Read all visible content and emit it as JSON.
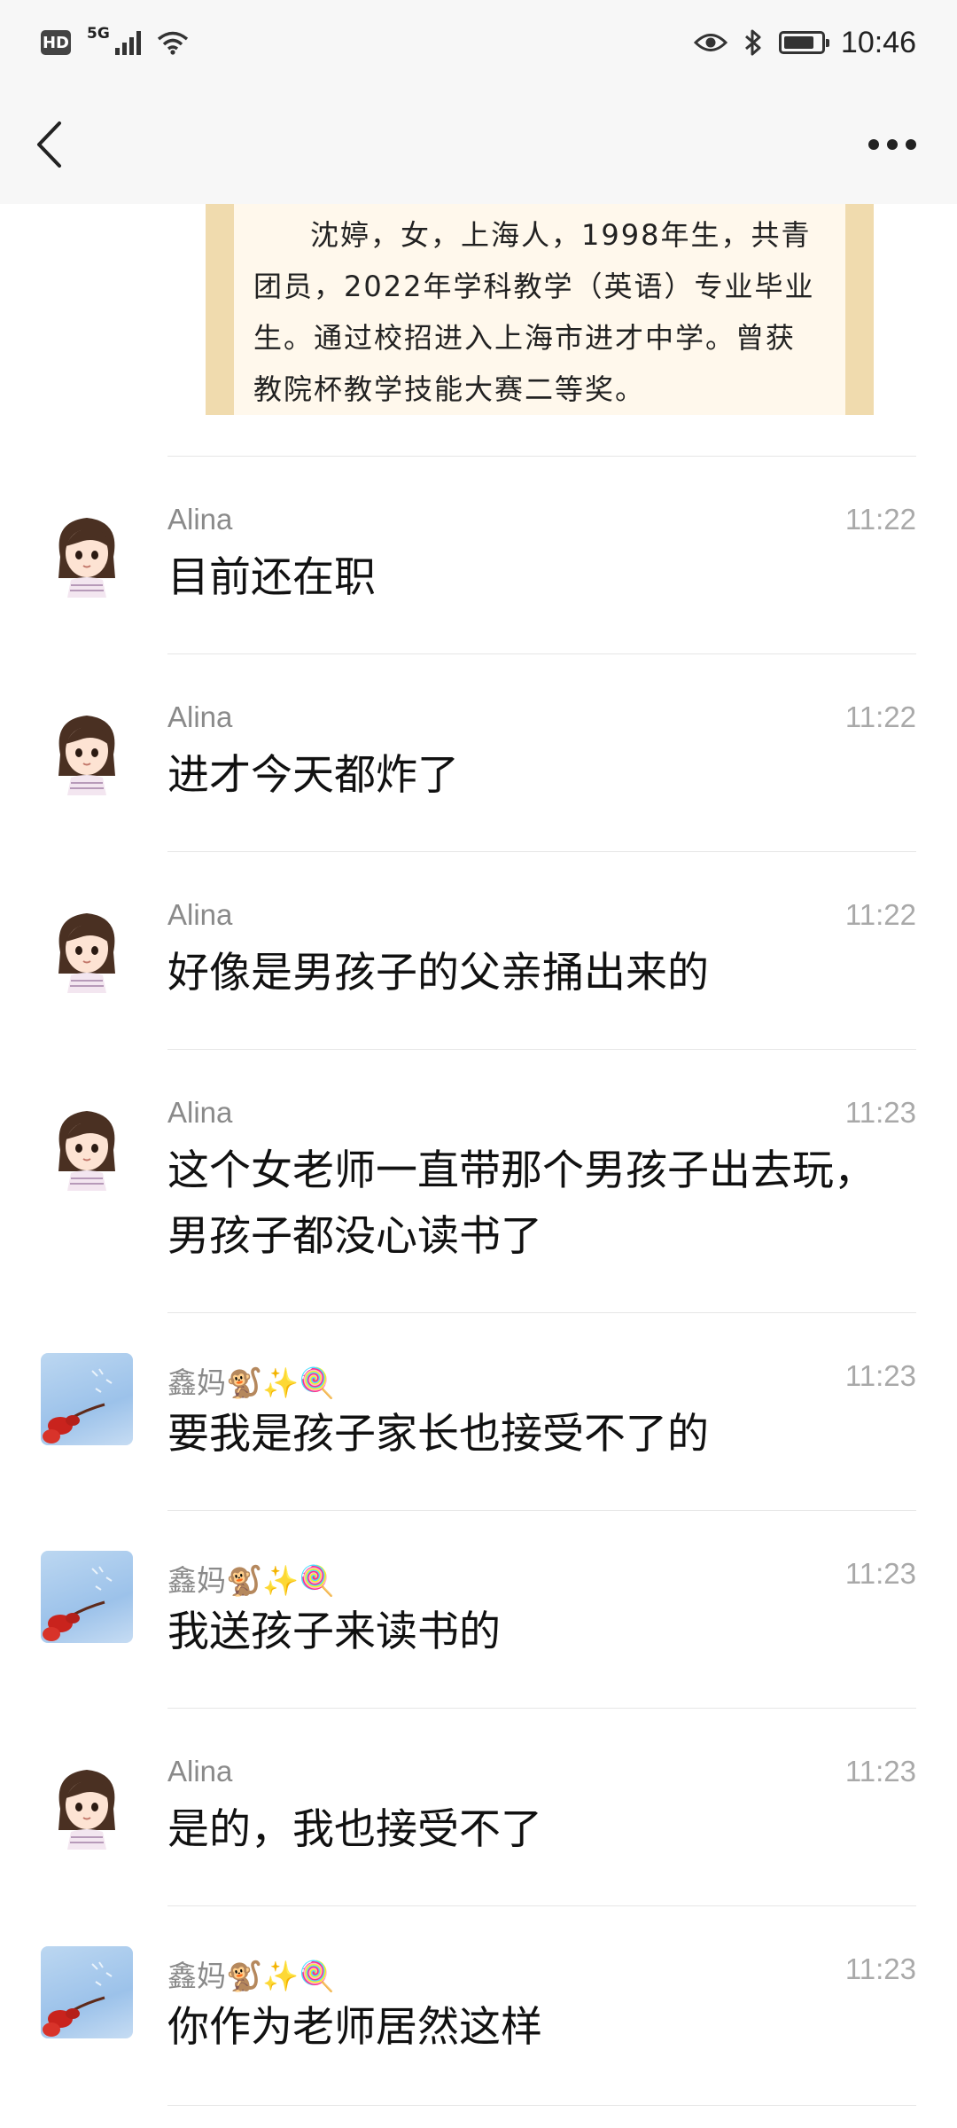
{
  "status_bar": {
    "hd": "HD",
    "network": "5G",
    "time": "10:46"
  },
  "header": {
    "back_icon": "back-chevron-icon",
    "more_icon": "more-dots-icon"
  },
  "article_image": {
    "text": "沈婷，女，上海人，1998年生，共青团员，2022年学科教学（英语）专业毕业生。通过校招进入上海市进才中学。曾获教院杯教学技能大赛二等奖。"
  },
  "messages": [
    {
      "sender": "Alina",
      "time": "11:22",
      "text": "目前还在职",
      "avatar": "girl-avatar"
    },
    {
      "sender": "Alina",
      "time": "11:22",
      "text": "进才今天都炸了",
      "avatar": "girl-avatar"
    },
    {
      "sender": "Alina",
      "time": "11:22",
      "text": "好像是男孩子的父亲捅出来的",
      "avatar": "girl-avatar"
    },
    {
      "sender": "Alina",
      "time": "11:23",
      "text": "这个女老师一直带那个男孩子出去玩，男孩子都没心读书了",
      "avatar": "girl-avatar"
    },
    {
      "sender": "鑫妈🐒✨🍭",
      "time": "11:23",
      "text": "要我是孩子家长也接受不了的",
      "avatar": "sky-flower-avatar"
    },
    {
      "sender": "鑫妈🐒✨🍭",
      "time": "11:23",
      "text": "我送孩子来读书的",
      "avatar": "sky-flower-avatar"
    },
    {
      "sender": "Alina",
      "time": "11:23",
      "text": "是的，我也接受不了",
      "avatar": "girl-avatar"
    },
    {
      "sender": "鑫妈🐒✨🍭",
      "time": "11:23",
      "text": "你作为老师居然这样",
      "avatar": "sky-flower-avatar"
    }
  ]
}
